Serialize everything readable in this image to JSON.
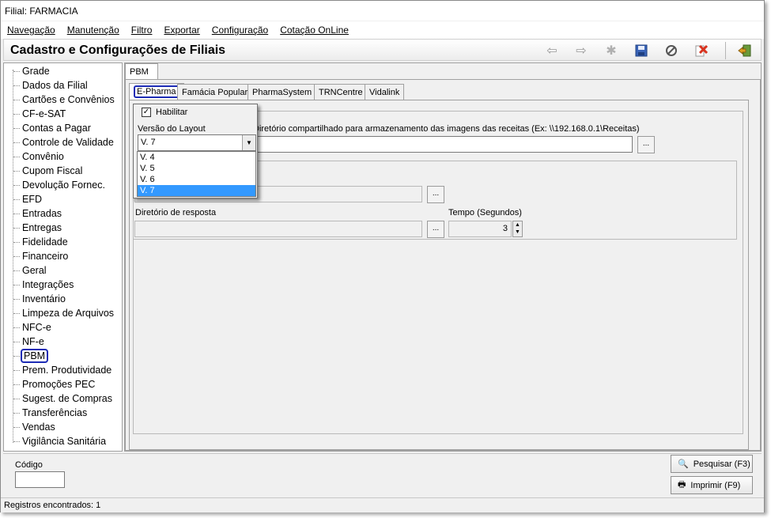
{
  "window": {
    "title": "Filial: FARMACIA"
  },
  "menu": [
    "Navegação",
    "Manutenção",
    "Filtro",
    "Exportar",
    "Configuração",
    "Cotação OnLine"
  ],
  "header": {
    "title": "Cadastro e Configurações de Filiais"
  },
  "toolbar": {
    "icons": [
      "back-arrow-icon",
      "forward-arrow-icon",
      "new-record-icon",
      "save-icon",
      "cancel-icon",
      "delete-icon",
      "exit-icon"
    ]
  },
  "sidebar": {
    "items": [
      "Grade",
      "Dados da Filial",
      "Cartões e Convênios",
      "CF-e-SAT",
      "Contas a Pagar",
      "Controle de Validade",
      "Convênio",
      "Cupom Fiscal",
      "Devolução Fornec.",
      "EFD",
      "Entradas",
      "Entregas",
      "Fidelidade",
      "Financeiro",
      "Geral",
      "Integrações",
      "Inventário",
      "Limpeza de Arquivos",
      "NFC-e",
      "NF-e",
      "PBM",
      "Prem. Produtividade",
      "Promoções PEC",
      "Sugest. de Compras",
      "Transferências",
      "Vendas",
      "Vigilância Sanitária"
    ],
    "selected": "PBM"
  },
  "main": {
    "outer_tab": "PBM",
    "inner_tabs": [
      "E-Pharma",
      "Famácia Popular",
      "PharmaSystem",
      "TRNCentre",
      "Vidalink"
    ],
    "active_inner_tab": "E-Pharma",
    "habilitar_label": "Habilitar",
    "habilitar_checked": true,
    "versao_label": "Versão do Layout",
    "versao_value": "V. 7",
    "versao_options": [
      "V. 4",
      "V. 5",
      "V. 6",
      "V. 7"
    ],
    "diretorio_compartilhado_label": "Diretório compartilhado para armazenamento das imagens das receitas (Ex: \\\\192.168.0.1\\Receitas)",
    "diretorio_compartilhado_value": "",
    "ellipsis": "...",
    "diretorio_resposta_label": "Diretório de resposta",
    "tempo_label": "Tempo (Segundos)",
    "tempo_value": "3"
  },
  "bottom": {
    "codigo_label": "Código",
    "codigo_value": "",
    "pesquisar_label": "Pesquisar (F3)",
    "imprimir_label": "Imprimir (F9)"
  },
  "status": {
    "text": "Registros encontrados: 1"
  }
}
